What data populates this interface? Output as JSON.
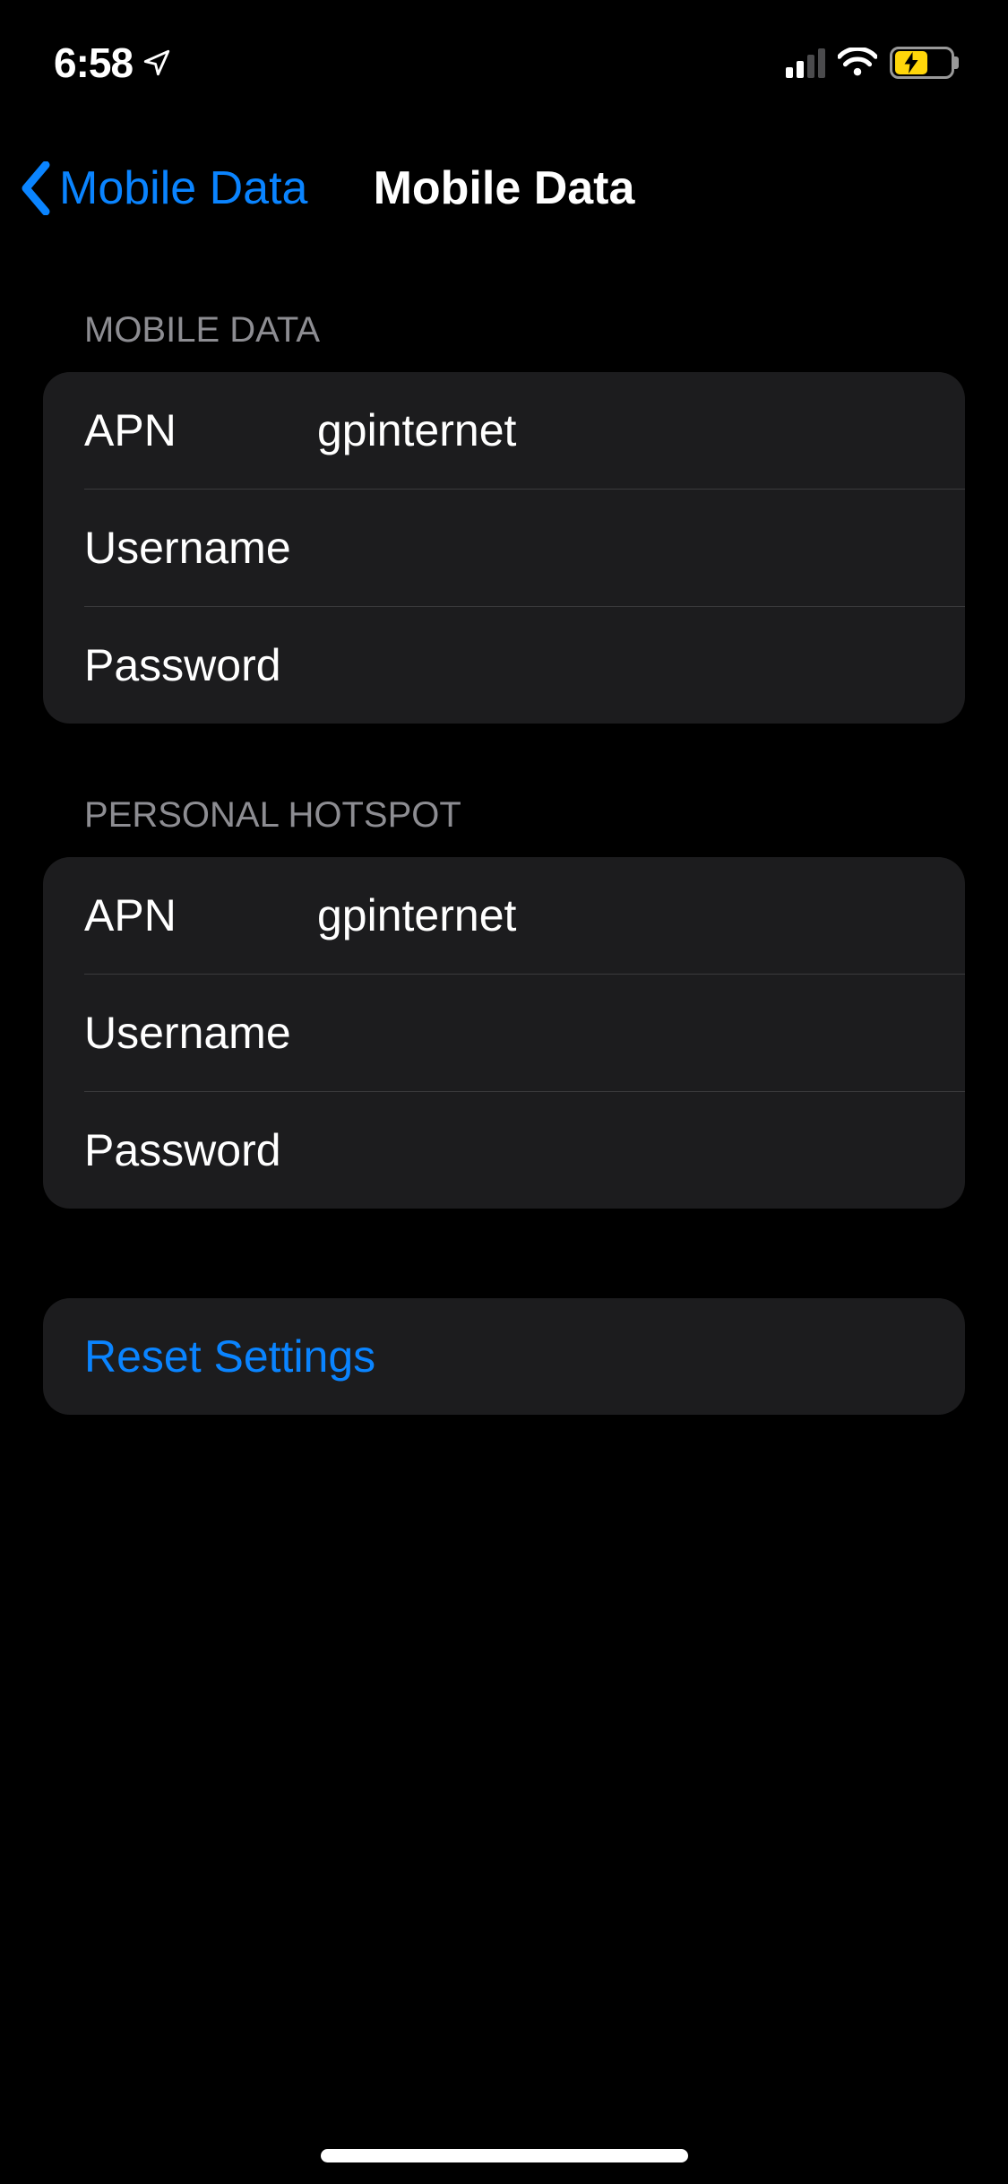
{
  "status": {
    "time": "6:58",
    "signal_bars_active": 2,
    "signal_bars_total": 4,
    "wifi_active": true,
    "battery_charging": true,
    "battery_color": "#ffd60a"
  },
  "nav": {
    "back_label": "Mobile Data",
    "title": "Mobile Data"
  },
  "sections": {
    "mobile_data": {
      "header": "Mobile Data",
      "apn_label": "APN",
      "apn_value": "gpinternet",
      "username_label": "Username",
      "username_value": "",
      "password_label": "Password",
      "password_value": ""
    },
    "personal_hotspot": {
      "header": "Personal Hotspot",
      "apn_label": "APN",
      "apn_value": "gpinternet",
      "username_label": "Username",
      "username_value": "",
      "password_label": "Password",
      "password_value": ""
    }
  },
  "reset": {
    "label": "Reset Settings"
  },
  "colors": {
    "accent": "#0a84ff"
  }
}
